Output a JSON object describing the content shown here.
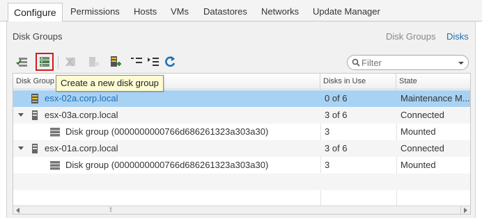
{
  "tabs": [
    {
      "label": "Configure",
      "active": true
    },
    {
      "label": "Permissions",
      "active": false
    },
    {
      "label": "Hosts",
      "active": false
    },
    {
      "label": "VMs",
      "active": false
    },
    {
      "label": "Datastores",
      "active": false
    },
    {
      "label": "Networks",
      "active": false
    },
    {
      "label": "Update Manager",
      "active": false
    }
  ],
  "panel": {
    "title": "Disk Groups",
    "links": [
      "Disk Groups",
      "Disks"
    ]
  },
  "toolbar": {
    "icons": [
      "claim-disks-icon",
      "create-disk-group-icon",
      "remove-disk-group-icon",
      "add-disk-icon",
      "host-add-icon",
      "collapse-all-icon",
      "expand-all-icon",
      "refresh-icon"
    ]
  },
  "filter": {
    "placeholder": "Filter"
  },
  "tooltip": "Create a new disk group",
  "columns": [
    "Disk Group",
    "Disks in Use",
    "State"
  ],
  "rows": [
    {
      "name": "esx-02a.corp.local",
      "disks": "0 of 6",
      "state": "Maintenance M...",
      "type": "host",
      "selected": true
    },
    {
      "name": "esx-03a.corp.local",
      "disks": "3 of 6",
      "state": "Connected",
      "type": "host",
      "expanded": true
    },
    {
      "name": "Disk group (0000000000766d686261323a303a30)",
      "disks": "3",
      "state": "Mounted",
      "type": "diskgroup"
    },
    {
      "name": "esx-01a.corp.local",
      "disks": "3 of 6",
      "state": "Connected",
      "type": "host",
      "expanded": true
    },
    {
      "name": "Disk group (0000000000766d686261323a303a30)",
      "disks": "3",
      "state": "Mounted",
      "type": "diskgroup"
    }
  ],
  "colors": {
    "accent": "#1b6fb5",
    "selection": "#a8d2f4",
    "highlight": "#d11b1b",
    "tooltip_bg": "#fdfbd4"
  }
}
